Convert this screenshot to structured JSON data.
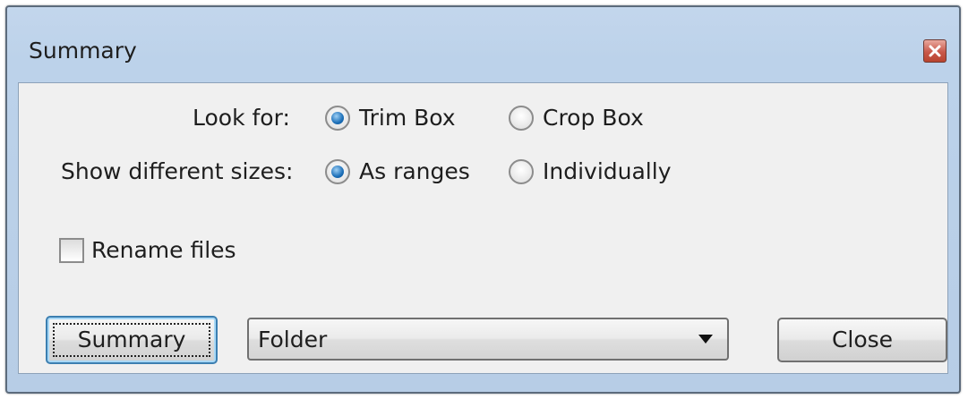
{
  "window": {
    "title": "Summary"
  },
  "look_for": {
    "label": "Look for:",
    "options": [
      {
        "label": "Trim Box",
        "selected": true
      },
      {
        "label": "Crop Box",
        "selected": false
      }
    ]
  },
  "show_sizes": {
    "label": "Show different sizes:",
    "options": [
      {
        "label": "As ranges",
        "selected": true
      },
      {
        "label": "Individually",
        "selected": false
      }
    ]
  },
  "rename_files": {
    "label": "Rename files",
    "checked": false
  },
  "footer": {
    "summary_button": "Summary",
    "destination_select": "Folder",
    "close_button": "Close"
  },
  "icons": {
    "close": "close-icon",
    "dropdown": "chevron-down-icon"
  },
  "colors": {
    "frame": "#bcd2ea",
    "client": "#f0f0f0",
    "radio_selected": "#1c6fb8",
    "close_button": "#c8584a"
  }
}
